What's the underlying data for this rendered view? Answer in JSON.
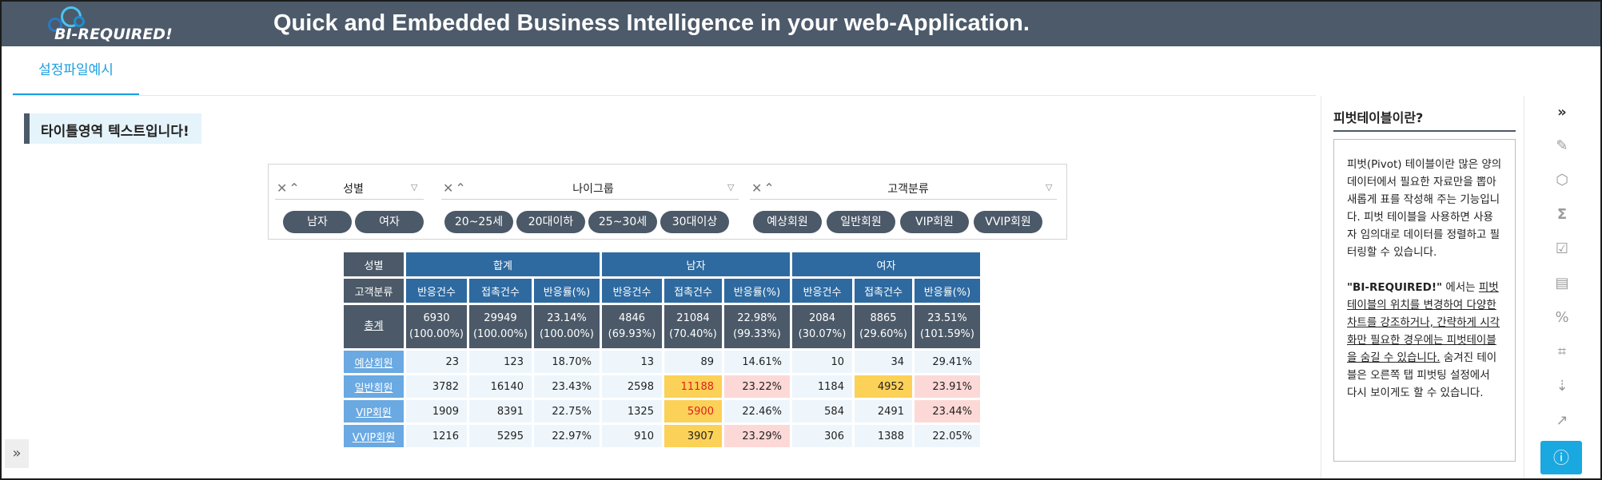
{
  "header": {
    "logo_text": "BI-REQUIRED!",
    "title": "Quick and Embedded Business Intelligence in your web-Application."
  },
  "tabs": [
    {
      "label": "설정파일예시",
      "active": true
    }
  ],
  "main": {
    "title": "타이틀영역 텍스트입니다!"
  },
  "filters": [
    {
      "label": "성별",
      "chips": [
        "남자",
        "여자"
      ]
    },
    {
      "label": "나이그룹",
      "chips": [
        "20~25세",
        "20대이하",
        "25~30세",
        "30대이상"
      ]
    },
    {
      "label": "고객분류",
      "chips": [
        "예상회원",
        "일반회원",
        "VIP회원",
        "VVIP회원"
      ]
    }
  ],
  "filter_controls": {
    "clear": "✕",
    "collapse": "⌃",
    "filter": "▽"
  },
  "pivot": {
    "col_dim": "성별",
    "row_dim": "고객분류",
    "groups": [
      "합계",
      "남자",
      "여자"
    ],
    "measures": [
      "반응건수",
      "접촉건수",
      "반응률(%)"
    ],
    "total": {
      "label": "총계",
      "cells": [
        [
          "6930",
          "(100.00%)"
        ],
        [
          "29949",
          "(100.00%)"
        ],
        [
          "23.14%",
          "(100.00%)"
        ],
        [
          "4846",
          "(69.93%)"
        ],
        [
          "21084",
          "(70.40%)"
        ],
        [
          "22.98%",
          "(99.33%)"
        ],
        [
          "2084",
          "(30.07%)"
        ],
        [
          "8865",
          "(29.60%)"
        ],
        [
          "23.51%",
          "(101.59%)"
        ]
      ]
    },
    "rows": [
      {
        "label": "예상회원",
        "values": [
          "23",
          "123",
          "18.70%",
          "13",
          "89",
          "14.61%",
          "10",
          "34",
          "29.41%"
        ]
      },
      {
        "label": "일반회원",
        "values": [
          "3782",
          "16140",
          "23.43%",
          "2598",
          "11188",
          "23.22%",
          "1184",
          "4952",
          "23.91%"
        ]
      },
      {
        "label": "VIP회원",
        "values": [
          "1909",
          "8391",
          "22.75%",
          "1325",
          "5900",
          "22.46%",
          "584",
          "2491",
          "23.44%"
        ]
      },
      {
        "label": "VVIP회원",
        "values": [
          "1216",
          "5295",
          "22.97%",
          "910",
          "3907",
          "23.29%",
          "306",
          "1388",
          "22.05%"
        ]
      }
    ],
    "highlight_colors": {
      "yellow": "#fcd157",
      "pink": "#fcd9d7",
      "red_text": "#e02020"
    }
  },
  "right_panel": {
    "title": "피벗테이블이란?",
    "p1": "피벗(Pivot) 테이블이란 많은 양의 데이터에서 필요한 자료만을 뽑아 새롭게 표를 작성해 주는 기능입니다. 피벗 테이블을 사용하면 사용자 임의대로 데이터를 정렬하고 필터링할 수 있습니다.",
    "p2_bold": "\"BI-REQUIRED!\"",
    "p2_a": " 에서는 ",
    "p2_underline": "피벗테이블의 위치를 변경하여 다양한 차트를 강조하거나, 간략하게 시각화만 필요한 경우에는 피벗테이블을 숨길 수 있습니다.",
    "p2_b": " 숨겨진 테이블은 오른쪽 탭 피벗팅 설정에서 다시 보이게도 할 수 있습니다."
  },
  "toolbar_icons": [
    "collapse-right-icon",
    "edit-icon",
    "cube-icon",
    "sigma-icon",
    "checklist-icon",
    "layout-icon",
    "percent-icon",
    "crop-icon",
    "sort-icon",
    "chart-icon",
    "info-icon"
  ],
  "accent_color": "#1aa8e0",
  "dark_color": "#4b5968"
}
